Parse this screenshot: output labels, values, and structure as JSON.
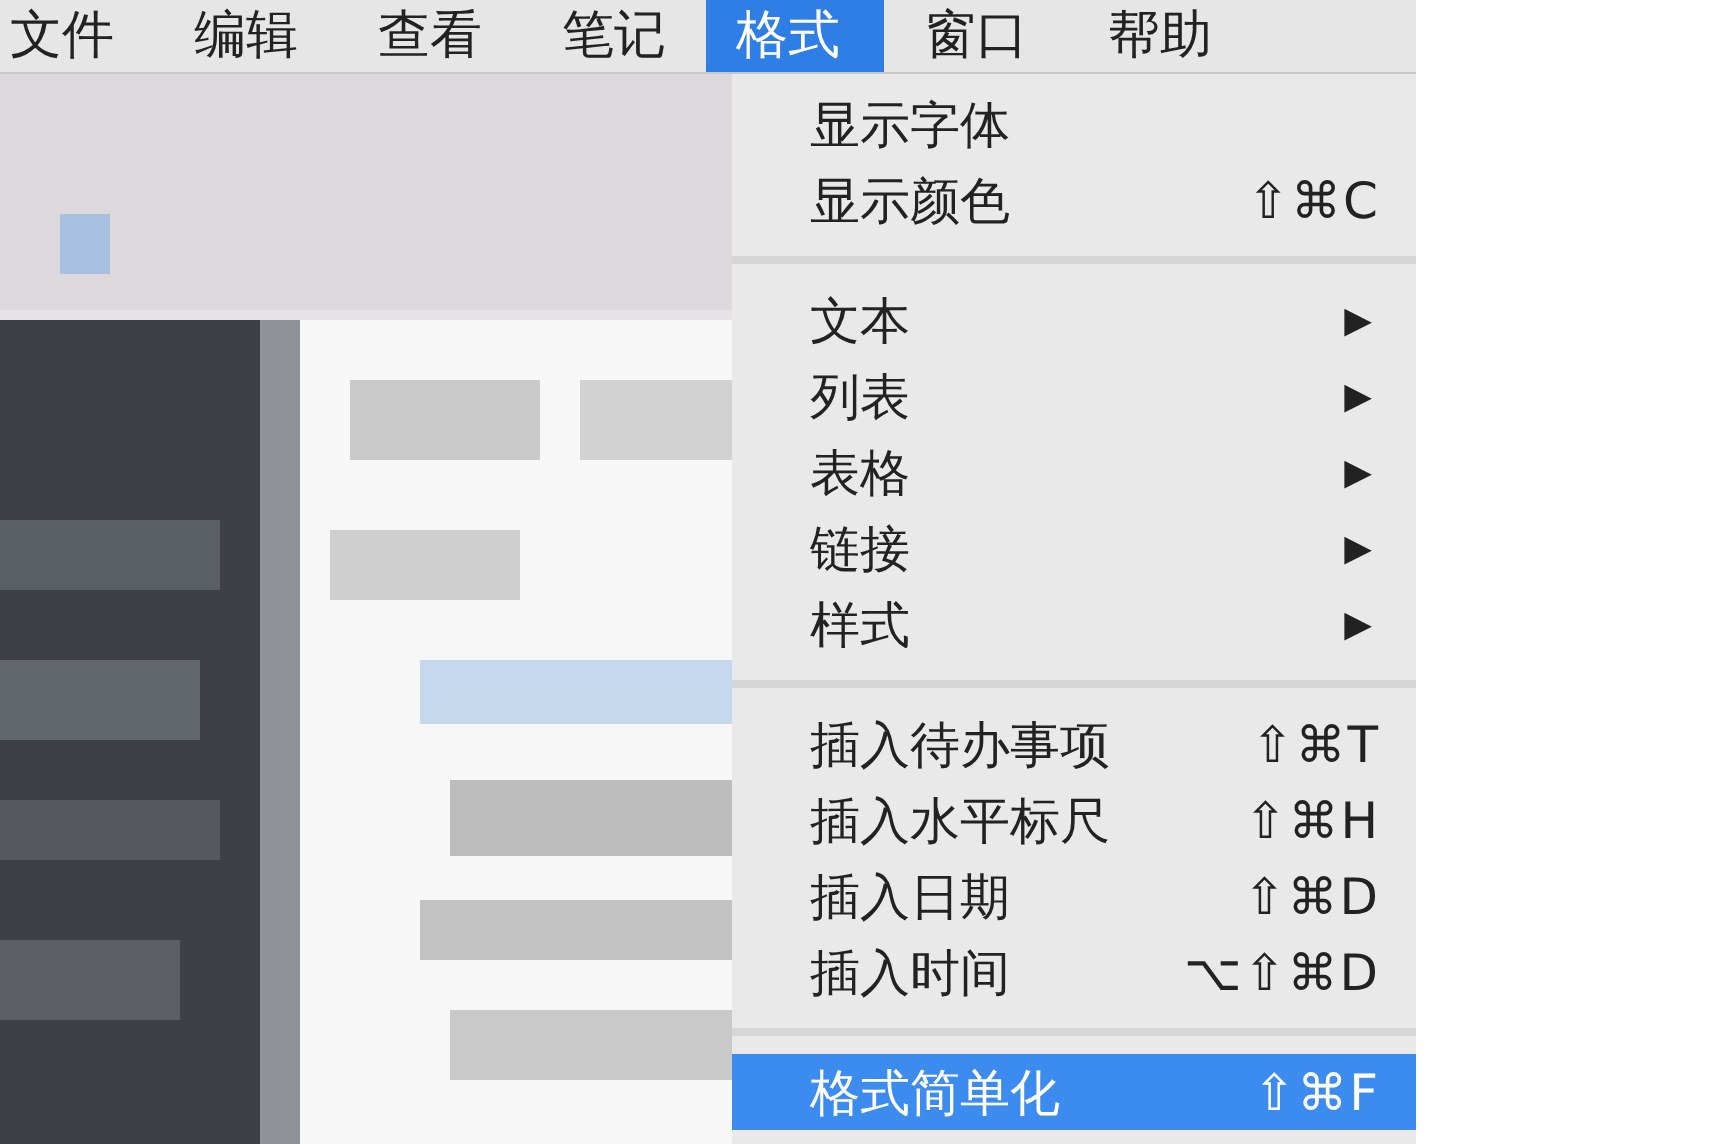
{
  "menu_bar": [
    {
      "label": "文件",
      "selected": false
    },
    {
      "label": "编辑",
      "selected": false
    },
    {
      "label": "查看",
      "selected": false
    },
    {
      "label": "笔记",
      "selected": false
    },
    {
      "label": "格式",
      "selected": true
    },
    {
      "label": "窗口",
      "selected": false
    },
    {
      "label": "帮助",
      "selected": false
    }
  ],
  "menu": [
    {
      "kind": "item",
      "label": "显示字体",
      "selected": false
    },
    {
      "kind": "item",
      "label": "显示颜色",
      "shortcut": "⇧⌘C",
      "selected": false
    },
    {
      "kind": "separator"
    },
    {
      "kind": "submenu",
      "label": "文本",
      "arrow": "▶",
      "selected": false
    },
    {
      "kind": "submenu",
      "label": "列表",
      "arrow": "▶",
      "selected": false
    },
    {
      "kind": "submenu",
      "label": "表格",
      "arrow": "▶",
      "selected": false
    },
    {
      "kind": "submenu",
      "label": "链接",
      "arrow": "▶",
      "selected": false
    },
    {
      "kind": "submenu",
      "label": "样式",
      "arrow": "▶",
      "selected": false
    },
    {
      "kind": "separator"
    },
    {
      "kind": "item",
      "label": "插入待办事项",
      "shortcut": "⇧⌘T",
      "selected": false
    },
    {
      "kind": "item",
      "label": "插入水平标尺",
      "shortcut": "⇧⌘H",
      "selected": false
    },
    {
      "kind": "item",
      "label": "插入日期",
      "shortcut": "⇧⌘D",
      "selected": false
    },
    {
      "kind": "item",
      "label": "插入时间",
      "shortcut": "⌥⇧⌘D",
      "selected": false
    },
    {
      "kind": "separator"
    },
    {
      "kind": "item",
      "label": "格式简单化",
      "shortcut": "⇧⌘F",
      "selected": true
    }
  ]
}
